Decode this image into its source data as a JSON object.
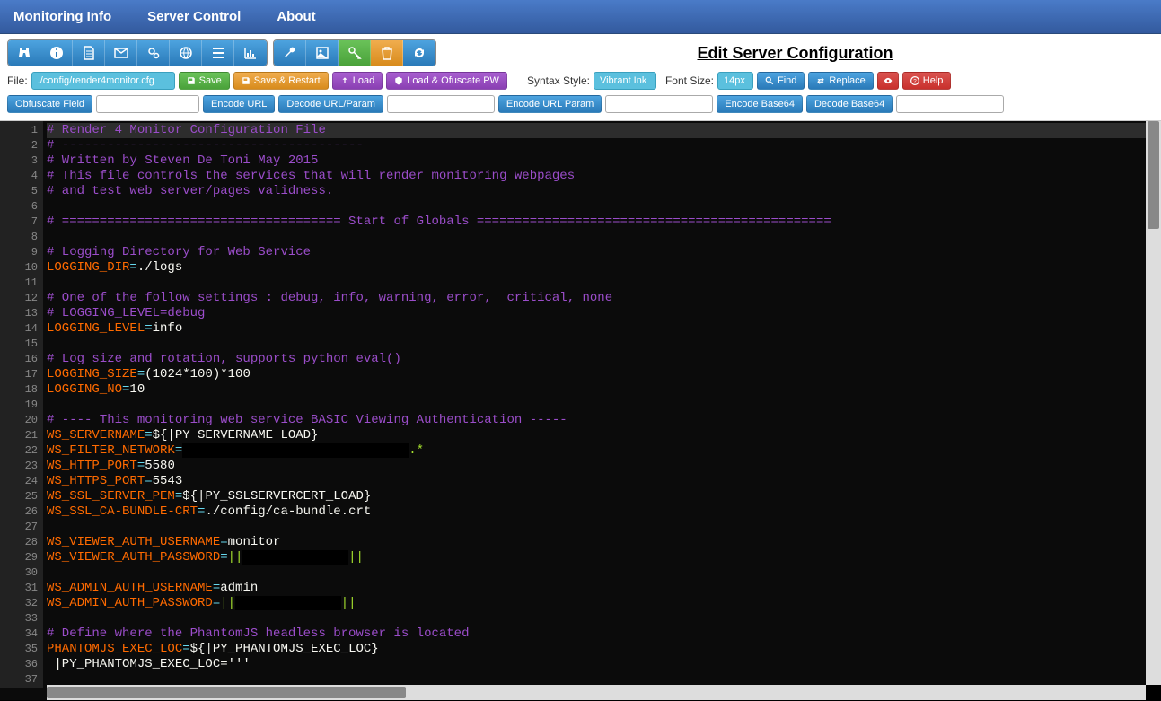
{
  "nav": {
    "monitoring": "Monitoring Info",
    "server_control": "Server Control",
    "about": "About"
  },
  "title": "Edit Server Configuration",
  "icon_groups": [
    {
      "name": "group-monitor",
      "buttons": [
        {
          "name": "binoculars-icon",
          "bg": "bg-blue"
        },
        {
          "name": "info-icon",
          "bg": "bg-blue"
        },
        {
          "name": "file-icon",
          "bg": "bg-blue"
        },
        {
          "name": "mail-icon",
          "bg": "bg-blue"
        },
        {
          "name": "gears-icon",
          "bg": "bg-blue"
        },
        {
          "name": "globe-icon",
          "bg": "bg-blue"
        },
        {
          "name": "tasks-icon",
          "bg": "bg-blue"
        },
        {
          "name": "chart-icon",
          "bg": "bg-blue"
        }
      ]
    },
    {
      "name": "group-actions",
      "buttons": [
        {
          "name": "wrench-icon",
          "bg": "bg-blue"
        },
        {
          "name": "image-icon",
          "bg": "bg-blue"
        },
        {
          "name": "key-icon",
          "bg": "bg-green"
        },
        {
          "name": "trash-icon",
          "bg": "bg-orange"
        },
        {
          "name": "refresh-icon",
          "bg": "bg-blue"
        }
      ]
    }
  ],
  "row2": {
    "file_label": "File:",
    "file_value": "./config/render4monitor.cfg",
    "save": "Save",
    "save_restart": "Save & Restart",
    "load": "Load",
    "load_ofuscate": "Load & Ofuscate PW",
    "syntax_label": "Syntax Style:",
    "syntax_value": "Vibrant Ink",
    "font_label": "Font Size:",
    "font_value": "14px",
    "find": "Find",
    "replace": "Replace",
    "help": "Help"
  },
  "row3": {
    "obfuscate": "Obfuscate Field",
    "encode_url": "Encode URL",
    "decode_url": "Decode URL/Param",
    "encode_url_param": "Encode URL Param",
    "encode_b64": "Encode Base64",
    "decode_b64": "Decode Base64"
  },
  "code_lines": [
    {
      "n": 1,
      "cls": "hl-first",
      "html": [
        {
          "c": "c-comment",
          "t": "# Render 4 Monitor Configuration File"
        }
      ]
    },
    {
      "n": 2,
      "html": [
        {
          "c": "c-comment",
          "t": "# ----------------------------------------"
        }
      ]
    },
    {
      "n": 3,
      "html": [
        {
          "c": "c-comment",
          "t": "# Written by Steven De Toni May 2015"
        }
      ]
    },
    {
      "n": 4,
      "html": [
        {
          "c": "c-comment",
          "t": "# This file controls the services that will render monitoring webpages"
        }
      ]
    },
    {
      "n": 5,
      "html": [
        {
          "c": "c-comment",
          "t": "# and test web server/pages validness."
        }
      ]
    },
    {
      "n": 6,
      "html": []
    },
    {
      "n": 7,
      "html": [
        {
          "c": "c-comment",
          "t": "# ===================================== Start of Globals ==============================================="
        }
      ]
    },
    {
      "n": 8,
      "html": []
    },
    {
      "n": 9,
      "html": [
        {
          "c": "c-comment",
          "t": "# Logging Directory for Web Service"
        }
      ]
    },
    {
      "n": 10,
      "html": [
        {
          "c": "c-key",
          "t": "LOGGING_DIR"
        },
        {
          "c": "c-op",
          "t": "="
        },
        {
          "c": "c-val",
          "t": "./logs"
        }
      ]
    },
    {
      "n": 11,
      "html": []
    },
    {
      "n": 12,
      "html": [
        {
          "c": "c-comment",
          "t": "# One of the follow settings : debug, info, warning, error,  critical, none"
        }
      ]
    },
    {
      "n": 13,
      "html": [
        {
          "c": "c-comment",
          "t": "# LOGGING_LEVEL=debug"
        }
      ]
    },
    {
      "n": 14,
      "html": [
        {
          "c": "c-key",
          "t": "LOGGING_LEVEL"
        },
        {
          "c": "c-op",
          "t": "="
        },
        {
          "c": "c-val",
          "t": "info"
        }
      ]
    },
    {
      "n": 15,
      "html": []
    },
    {
      "n": 16,
      "html": [
        {
          "c": "c-comment",
          "t": "# Log size and rotation, supports python eval()"
        }
      ]
    },
    {
      "n": 17,
      "html": [
        {
          "c": "c-key",
          "t": "LOGGING_SIZE"
        },
        {
          "c": "c-op",
          "t": "="
        },
        {
          "c": "c-val",
          "t": "(1024*100)*100"
        }
      ]
    },
    {
      "n": 18,
      "html": [
        {
          "c": "c-key",
          "t": "LOGGING_NO"
        },
        {
          "c": "c-op",
          "t": "="
        },
        {
          "c": "c-val",
          "t": "10"
        }
      ]
    },
    {
      "n": 19,
      "html": []
    },
    {
      "n": 20,
      "html": [
        {
          "c": "c-comment",
          "t": "# ---- This monitoring web service BASIC Viewing Authentication -----"
        }
      ]
    },
    {
      "n": 21,
      "html": [
        {
          "c": "c-key",
          "t": "WS_SERVERNAME"
        },
        {
          "c": "c-op",
          "t": "="
        },
        {
          "c": "c-val",
          "t": "${|PY SERVERNAME LOAD}"
        }
      ]
    },
    {
      "n": 22,
      "html": [
        {
          "c": "c-key",
          "t": "WS_FILTER_NETWORK"
        },
        {
          "c": "c-op",
          "t": "="
        },
        {
          "c": "redact",
          "t": "                              "
        },
        {
          "c": "c-green",
          "t": ".*"
        }
      ]
    },
    {
      "n": 23,
      "html": [
        {
          "c": "c-key",
          "t": "WS_HTTP_PORT"
        },
        {
          "c": "c-op",
          "t": "="
        },
        {
          "c": "c-val",
          "t": "5580"
        }
      ]
    },
    {
      "n": 24,
      "html": [
        {
          "c": "c-key",
          "t": "WS_HTTPS_PORT"
        },
        {
          "c": "c-op",
          "t": "="
        },
        {
          "c": "c-val",
          "t": "5543"
        }
      ]
    },
    {
      "n": 25,
      "html": [
        {
          "c": "c-key",
          "t": "WS_SSL_SERVER_PEM"
        },
        {
          "c": "c-op",
          "t": "="
        },
        {
          "c": "c-val",
          "t": "${|PY_SSLSERVERCERT_LOAD}"
        }
      ]
    },
    {
      "n": 26,
      "html": [
        {
          "c": "c-key",
          "t": "WS_SSL_CA-BUNDLE-CRT"
        },
        {
          "c": "c-op",
          "t": "="
        },
        {
          "c": "c-val",
          "t": "./config/ca-bundle.crt"
        }
      ]
    },
    {
      "n": 27,
      "html": []
    },
    {
      "n": 28,
      "html": [
        {
          "c": "c-key",
          "t": "WS_VIEWER_AUTH_USERNAME"
        },
        {
          "c": "c-op",
          "t": "="
        },
        {
          "c": "c-val",
          "t": "monitor"
        }
      ]
    },
    {
      "n": 29,
      "html": [
        {
          "c": "c-key",
          "t": "WS_VIEWER_AUTH_PASSWORD"
        },
        {
          "c": "c-op",
          "t": "="
        },
        {
          "c": "c-green",
          "t": "||"
        },
        {
          "c": "redact",
          "t": "              "
        },
        {
          "c": "c-green",
          "t": "||"
        }
      ]
    },
    {
      "n": 30,
      "html": []
    },
    {
      "n": 31,
      "html": [
        {
          "c": "c-key",
          "t": "WS_ADMIN_AUTH_USERNAME"
        },
        {
          "c": "c-op",
          "t": "="
        },
        {
          "c": "c-val",
          "t": "admin"
        }
      ]
    },
    {
      "n": 32,
      "html": [
        {
          "c": "c-key",
          "t": "WS_ADMIN_AUTH_PASSWORD"
        },
        {
          "c": "c-op",
          "t": "="
        },
        {
          "c": "c-green",
          "t": "||"
        },
        {
          "c": "redact",
          "t": "              "
        },
        {
          "c": "c-green",
          "t": "||"
        }
      ]
    },
    {
      "n": 33,
      "html": []
    },
    {
      "n": 34,
      "html": [
        {
          "c": "c-comment",
          "t": "# Define where the PhantomJS headless browser is located"
        }
      ]
    },
    {
      "n": 35,
      "html": [
        {
          "c": "c-key",
          "t": "PHANTOMJS_EXEC_LOC"
        },
        {
          "c": "c-op",
          "t": "="
        },
        {
          "c": "c-val",
          "t": "${|PY_PHANTOMJS_EXEC_LOC}"
        }
      ]
    },
    {
      "n": 36,
      "html": [
        {
          "c": "c-val",
          "t": " |PY_PHANTOMJS_EXEC_LOC='''"
        }
      ]
    },
    {
      "n": 37,
      "html": []
    }
  ]
}
